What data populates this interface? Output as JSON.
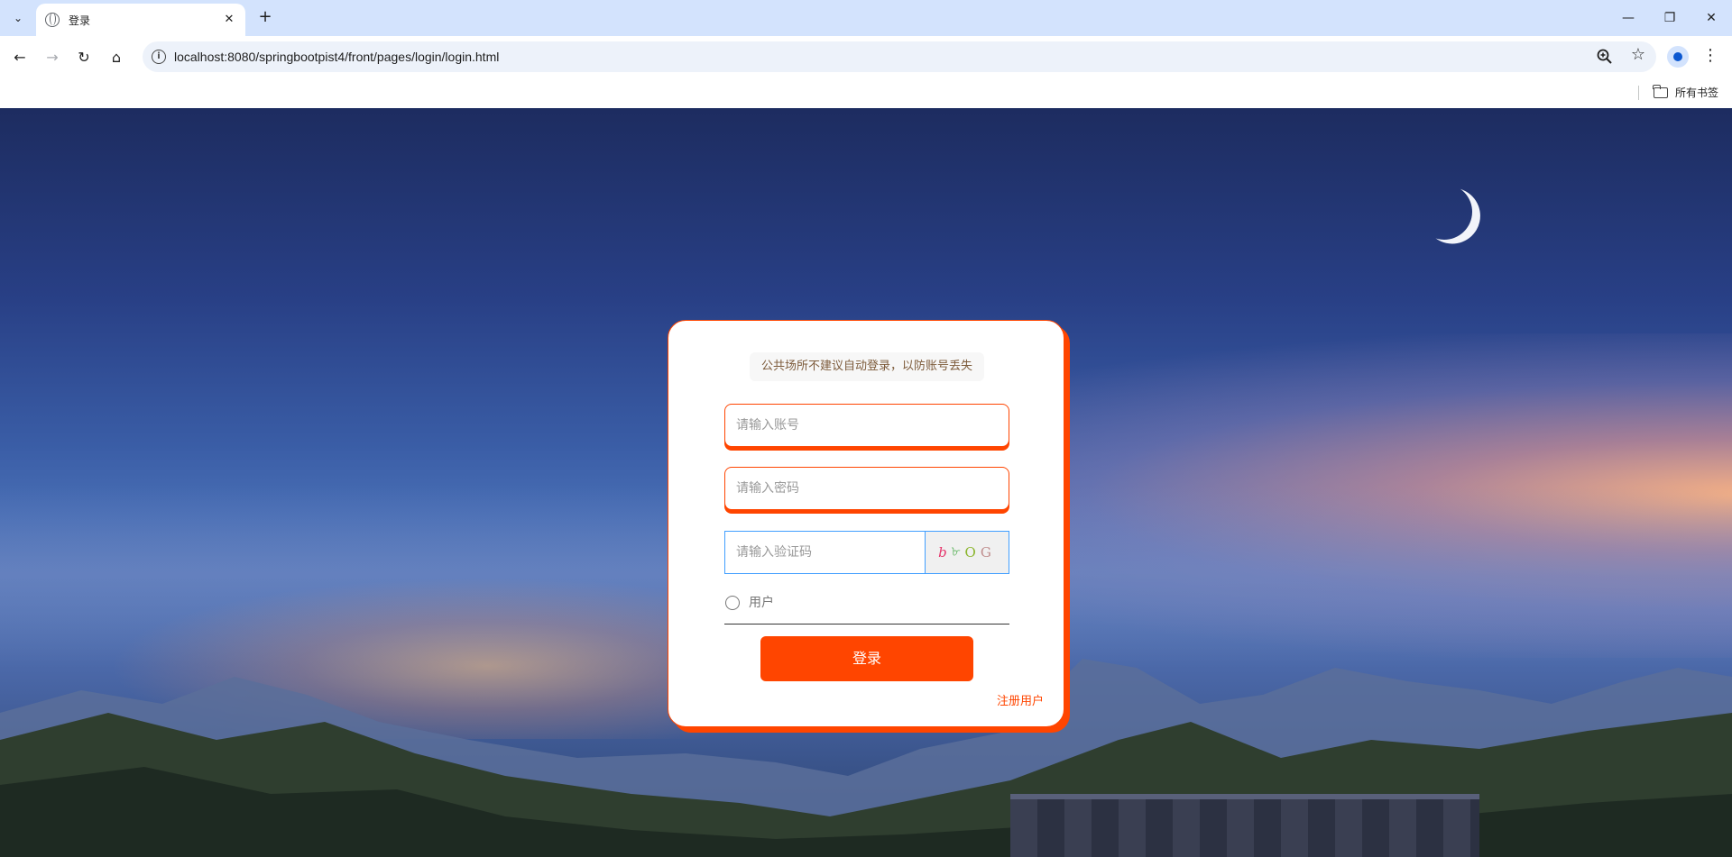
{
  "browser": {
    "tab_title": "登录",
    "url": "localhost:8080/springbootpist4/front/pages/login/login.html",
    "bookmarks_label": "所有书签"
  },
  "login": {
    "notice": "公共场所不建议自动登录，以防账号丢失",
    "account_placeholder": "请输入账号",
    "password_placeholder": "请输入密码",
    "captcha_placeholder": "请输入验证码",
    "captcha_chars": [
      "b",
      "৮",
      "O",
      "G"
    ],
    "role_option": "用户",
    "role_selected": false,
    "login_button": "登录",
    "register_link": "注册用户"
  },
  "colors": {
    "accent": "#ff4500",
    "captcha_border": "#409eff"
  }
}
